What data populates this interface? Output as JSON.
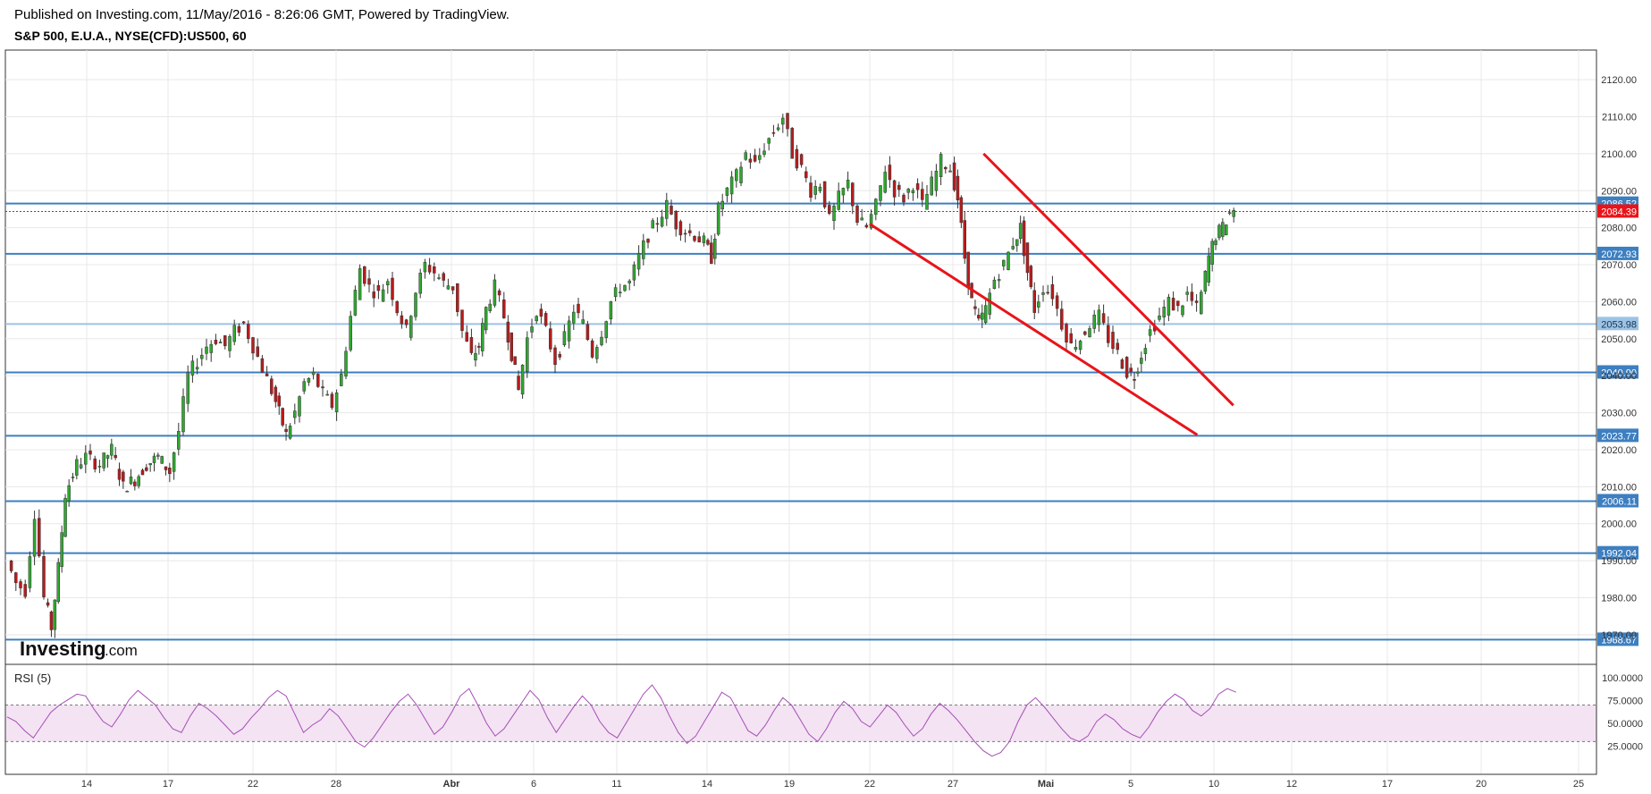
{
  "header": {
    "published": "Published on Investing.com, 11/May/2016 - 8:26:06 GMT, Powered by TradingView.",
    "symbol": "S&P 500, E.U.A., NYSE(CFD):US500, 60"
  },
  "logo": {
    "brand": "Investing",
    "suffix": ".com"
  },
  "chart_data": {
    "type": "candlestick",
    "price_axis": {
      "min": 1962,
      "max": 2128,
      "ticks": [
        1970,
        1980,
        1990,
        2000,
        2010,
        2020,
        2030,
        2040,
        2050,
        2060,
        2070,
        2080,
        2090,
        2100,
        2110,
        2120
      ],
      "tick_format": "fixed2"
    },
    "time_labels": [
      "14",
      "17",
      "22",
      "28",
      "Abr",
      "6",
      "11",
      "14",
      "19",
      "22",
      "27",
      "Mai",
      "5",
      "10",
      "12",
      "17",
      "20",
      "25"
    ],
    "last_price": 2084.39,
    "horizontal_levels": [
      {
        "value": 2086.52,
        "label": "2086.52",
        "color": "#3d7fc1"
      },
      {
        "value": 2072.93,
        "label": "2072.93",
        "color": "#3d7fc1"
      },
      {
        "value": 2053.98,
        "label": "2053.98",
        "color": "#9cc3e4"
      },
      {
        "value": 2040.9,
        "label": "2040.90",
        "color": "#3d7fc1"
      },
      {
        "value": 2023.77,
        "label": "2023.77",
        "color": "#3d7fc1"
      },
      {
        "value": 2006.11,
        "label": "2006.11",
        "color": "#3d7fc1"
      },
      {
        "value": 1992.04,
        "label": "1992.04",
        "color": "#3d7fc1"
      },
      {
        "value": 1968.67,
        "label": "1968.67",
        "color": "#3d7fc1"
      }
    ],
    "trendlines": [
      {
        "from_label": "22",
        "from_price": 2081,
        "to_label": "5-10 (~4/5)",
        "to_price": 2024,
        "color": "#e8141a"
      },
      {
        "from_label": "27-Mai (~1/3)",
        "from_price": 2100,
        "to_label": "10 (~1/4)",
        "to_price": 2032,
        "color": "#e8141a"
      }
    ],
    "price_path": [
      [
        0,
        1990
      ],
      [
        0.4,
        1984
      ],
      [
        0.8,
        1982
      ],
      [
        1.2,
        2003
      ],
      [
        1.6,
        1980
      ],
      [
        1.9,
        1972
      ],
      [
        2.2,
        1988
      ],
      [
        2.5,
        2008
      ],
      [
        3.0,
        2016
      ],
      [
        3.4,
        2018
      ],
      [
        4.0,
        2016
      ],
      [
        4.5,
        2020
      ],
      [
        5.0,
        2010
      ],
      [
        5.5,
        2012
      ],
      [
        6.0,
        2016
      ],
      [
        6.5,
        2018
      ],
      [
        7.0,
        2014
      ],
      [
        7.4,
        2025
      ],
      [
        7.8,
        2040
      ],
      [
        8.2,
        2044
      ],
      [
        8.6,
        2048
      ],
      [
        9.0,
        2050
      ],
      [
        9.4,
        2048
      ],
      [
        9.8,
        2052
      ],
      [
        10.2,
        2054
      ],
      [
        10.6,
        2048
      ],
      [
        11.0,
        2042
      ],
      [
        11.4,
        2036
      ],
      [
        11.7,
        2030
      ],
      [
        12.0,
        2024
      ],
      [
        12.4,
        2030
      ],
      [
        12.8,
        2038
      ],
      [
        13.2,
        2040
      ],
      [
        13.6,
        2035
      ],
      [
        14.0,
        2032
      ],
      [
        14.4,
        2040
      ],
      [
        14.8,
        2056
      ],
      [
        15.2,
        2069
      ],
      [
        15.6,
        2064
      ],
      [
        16.0,
        2062
      ],
      [
        16.4,
        2066
      ],
      [
        16.8,
        2058
      ],
      [
        17.2,
        2052
      ],
      [
        17.6,
        2063
      ],
      [
        18.0,
        2070
      ],
      [
        18.4,
        2068
      ],
      [
        18.8,
        2065
      ],
      [
        19.2,
        2064
      ],
      [
        19.6,
        2052
      ],
      [
        20.0,
        2045
      ],
      [
        20.3,
        2048
      ],
      [
        20.6,
        2058
      ],
      [
        21.0,
        2064
      ],
      [
        21.4,
        2056
      ],
      [
        21.7,
        2046
      ],
      [
        22.0,
        2036
      ],
      [
        22.4,
        2050
      ],
      [
        22.8,
        2058
      ],
      [
        23.2,
        2052
      ],
      [
        23.6,
        2044
      ],
      [
        24.0,
        2050
      ],
      [
        24.4,
        2058
      ],
      [
        24.8,
        2054
      ],
      [
        25.2,
        2046
      ],
      [
        25.6,
        2052
      ],
      [
        26.0,
        2060
      ],
      [
        26.4,
        2064
      ],
      [
        26.8,
        2065
      ],
      [
        27.2,
        2072
      ],
      [
        27.6,
        2078
      ],
      [
        28.0,
        2082
      ],
      [
        28.4,
        2086
      ],
      [
        28.8,
        2081
      ],
      [
        29.2,
        2079
      ],
      [
        29.6,
        2078
      ],
      [
        30.0,
        2076
      ],
      [
        30.3,
        2072
      ],
      [
        30.6,
        2085
      ],
      [
        31.0,
        2090
      ],
      [
        31.4,
        2094
      ],
      [
        31.8,
        2100
      ],
      [
        32.2,
        2097
      ],
      [
        32.6,
        2102
      ],
      [
        33.0,
        2106
      ],
      [
        33.4,
        2110
      ],
      [
        33.8,
        2100
      ],
      [
        34.2,
        2096
      ],
      [
        34.6,
        2090
      ],
      [
        35.0,
        2092
      ],
      [
        35.4,
        2082
      ],
      [
        35.8,
        2088
      ],
      [
        36.2,
        2092
      ],
      [
        36.6,
        2082
      ],
      [
        37.0,
        2080
      ],
      [
        37.4,
        2086
      ],
      [
        37.8,
        2096
      ],
      [
        38.2,
        2090
      ],
      [
        38.6,
        2088
      ],
      [
        39.0,
        2092
      ],
      [
        39.4,
        2086
      ],
      [
        39.8,
        2092
      ],
      [
        40.2,
        2098
      ],
      [
        40.6,
        2096
      ],
      [
        40.9,
        2088
      ],
      [
        41.2,
        2072
      ],
      [
        41.5,
        2060
      ],
      [
        41.8,
        2054
      ],
      [
        42.1,
        2058
      ],
      [
        42.5,
        2066
      ],
      [
        42.9,
        2070
      ],
      [
        43.3,
        2076
      ],
      [
        43.6,
        2080
      ],
      [
        43.9,
        2068
      ],
      [
        44.2,
        2058
      ],
      [
        44.6,
        2064
      ],
      [
        45.0,
        2062
      ],
      [
        45.4,
        2054
      ],
      [
        45.8,
        2048
      ],
      [
        46.2,
        2050
      ],
      [
        46.6,
        2054
      ],
      [
        47.0,
        2056
      ],
      [
        47.4,
        2050
      ],
      [
        47.8,
        2046
      ],
      [
        48.2,
        2041
      ],
      [
        48.5,
        2040
      ],
      [
        48.8,
        2046
      ],
      [
        49.2,
        2052
      ],
      [
        49.6,
        2056
      ],
      [
        50.0,
        2060
      ],
      [
        50.4,
        2058
      ],
      [
        50.8,
        2062
      ],
      [
        51.2,
        2058
      ],
      [
        51.4,
        2062
      ],
      [
        51.7,
        2072
      ],
      [
        52.0,
        2078
      ],
      [
        52.3,
        2080
      ],
      [
        52.6,
        2084
      ],
      [
        52.8,
        2085
      ]
    ]
  },
  "rsi": {
    "label": "RSI (5)",
    "ticks": [
      {
        "value": 100,
        "label": "100.0000"
      },
      {
        "value": 75,
        "label": "75.0000"
      },
      {
        "value": 50,
        "label": "50.0000"
      },
      {
        "value": 25,
        "label": "25.0000"
      }
    ],
    "band": [
      30,
      70
    ],
    "color": "#a64db5",
    "values": [
      57,
      52,
      42,
      34,
      48,
      62,
      70,
      76,
      82,
      80,
      65,
      52,
      46,
      60,
      76,
      86,
      78,
      70,
      56,
      44,
      40,
      58,
      72,
      66,
      58,
      48,
      38,
      44,
      56,
      66,
      78,
      86,
      80,
      60,
      40,
      48,
      54,
      66,
      58,
      44,
      30,
      24,
      34,
      48,
      62,
      74,
      82,
      70,
      54,
      38,
      46,
      62,
      80,
      88,
      70,
      50,
      36,
      44,
      58,
      72,
      86,
      76,
      56,
      40,
      54,
      68,
      80,
      70,
      52,
      40,
      34,
      50,
      66,
      82,
      92,
      78,
      58,
      40,
      28,
      36,
      52,
      68,
      84,
      78,
      60,
      42,
      36,
      48,
      64,
      78,
      70,
      54,
      38,
      30,
      44,
      62,
      74,
      66,
      52,
      46,
      58,
      70,
      62,
      48,
      36,
      44,
      60,
      72,
      64,
      54,
      42,
      30,
      20,
      14,
      18,
      30,
      52,
      70,
      78,
      68,
      56,
      44,
      34,
      30,
      36,
      52,
      60,
      54,
      44,
      38,
      34,
      46,
      62,
      74,
      82,
      76,
      64,
      58,
      66,
      82,
      88,
      84
    ]
  }
}
